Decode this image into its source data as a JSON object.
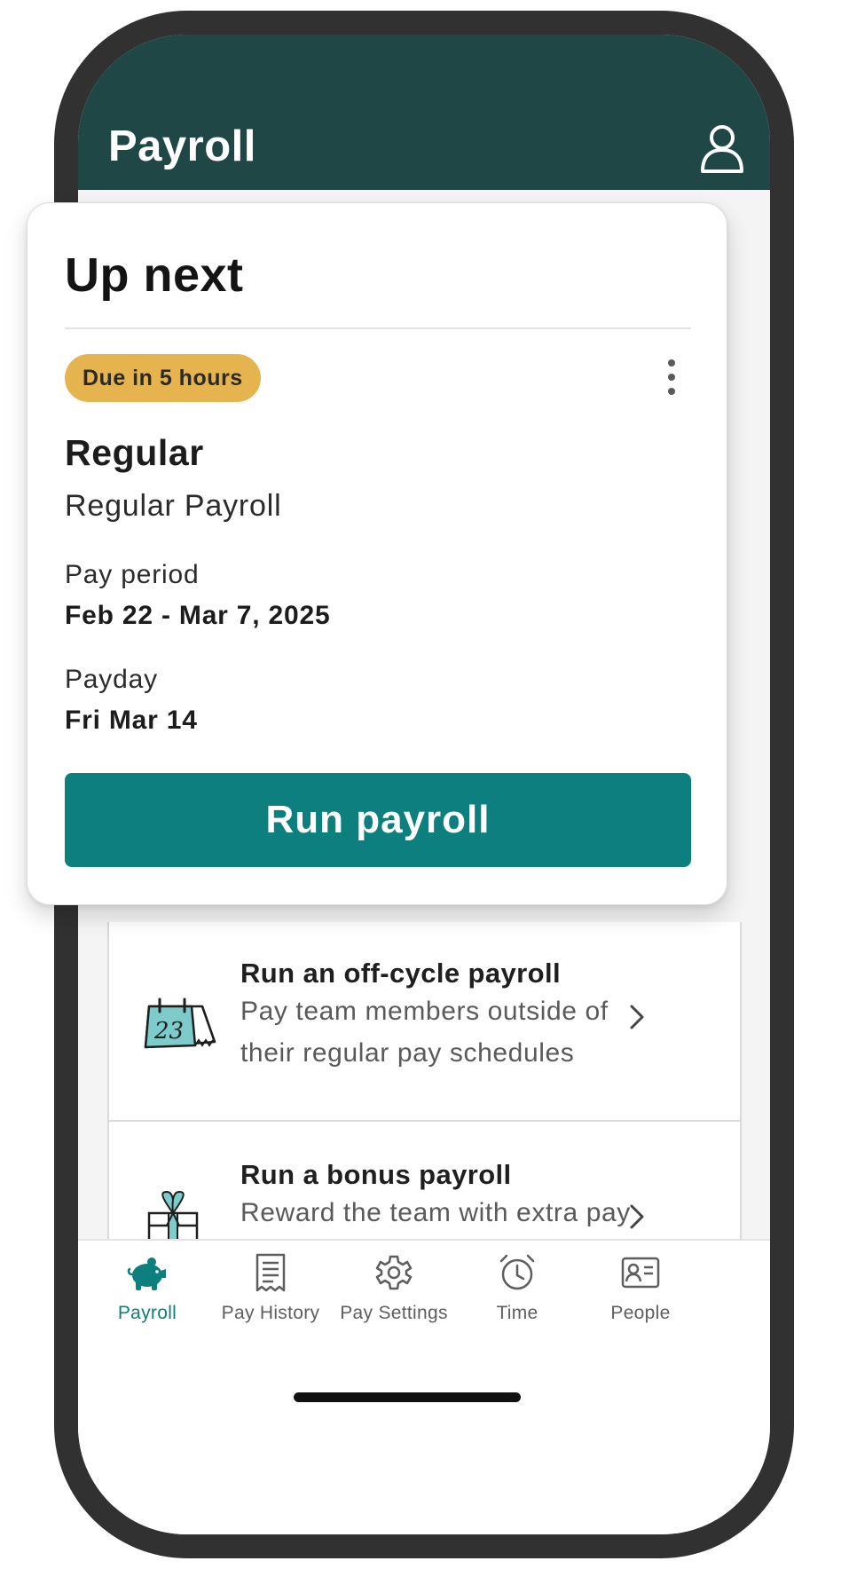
{
  "header": {
    "title": "Payroll",
    "profile_icon": "person-icon"
  },
  "card": {
    "heading": "Up next",
    "badge": "Due in 5 hours",
    "badge_color": "#e6b44e",
    "more_icon": "vertical-dots-icon",
    "payroll_type": "Regular",
    "payroll_name": "Regular Payroll",
    "pay_period_label": "Pay period",
    "pay_period_value": "Feb 22 - Mar 7, 2025",
    "payday_label": "Payday",
    "payday_value": "Fri Mar 14",
    "run_button": "Run payroll",
    "accent_color": "#0c7f7e"
  },
  "options": [
    {
      "title": "Run an off-cycle payroll",
      "description": "Pay team members outside of their regular pay schedules",
      "icon": "calendar-icon",
      "calendar_day": "23"
    },
    {
      "title": "Run a bonus payroll",
      "description": "Reward the team with extra pay",
      "icon": "gift-icon"
    }
  ],
  "nav": {
    "items": [
      {
        "label": "Payroll",
        "icon": "piggy-bank-icon",
        "active": true
      },
      {
        "label": "Pay History",
        "icon": "receipt-icon",
        "active": false
      },
      {
        "label": "Pay Settings",
        "icon": "gear-icon",
        "active": false
      },
      {
        "label": "Time",
        "icon": "alarm-clock-icon",
        "active": false
      },
      {
        "label": "People",
        "icon": "id-card-icon",
        "active": false
      }
    ]
  },
  "colors": {
    "header_bg": "#1e4745",
    "nav_active": "#0c7f7e",
    "nav_inactive": "#5e5e5e"
  }
}
